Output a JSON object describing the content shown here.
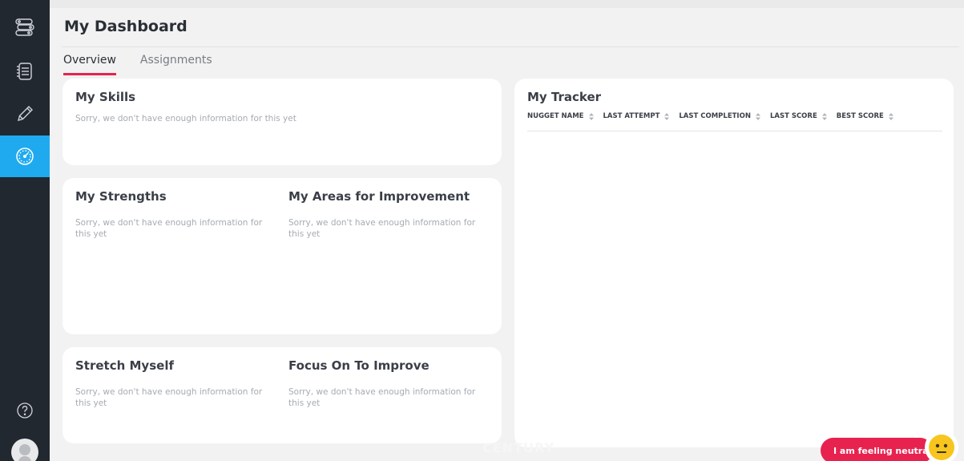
{
  "header": {
    "title": "My Dashboard"
  },
  "tabs": [
    {
      "label": "Overview"
    },
    {
      "label": "Assignments"
    }
  ],
  "skills": {
    "title": "My Skills",
    "message": "Sorry, we don't have enough information for this yet"
  },
  "strengths": {
    "title": "My Strengths",
    "message": "Sorry, we don't have enough information for this yet"
  },
  "improvement": {
    "title": "My Areas for Improvement",
    "message": "Sorry, we don't have enough information for this yet"
  },
  "stretch": {
    "title": "Stretch Myself",
    "message": "Sorry, we don't have enough information for this yet"
  },
  "focus": {
    "title": "Focus On To Improve",
    "message": "Sorry, we don't have enough information for this yet"
  },
  "tracker": {
    "title": "My Tracker",
    "columns": [
      "NUGGET NAME",
      "LAST ATTEMPT",
      "LAST COMPLETION",
      "LAST SCORE",
      "BEST SCORE"
    ]
  },
  "footer": {
    "brand": "CENTURY",
    "mood_label": "I am feeling neutral"
  },
  "icons": {
    "nav": [
      "pathway-icon",
      "courses-list-icon",
      "pencil-icon",
      "dashboard-gauge-icon"
    ],
    "help": "help-icon",
    "avatar": "avatar-icon",
    "mood": "neutral-face-icon"
  },
  "colors": {
    "sidebar_bg": "#212830",
    "active_nav": "#1faaf0",
    "accent": "#e8224f",
    "page_bg": "#f2f2f2",
    "card_bg": "#ffffff",
    "mood_face": "#f7c51e"
  }
}
